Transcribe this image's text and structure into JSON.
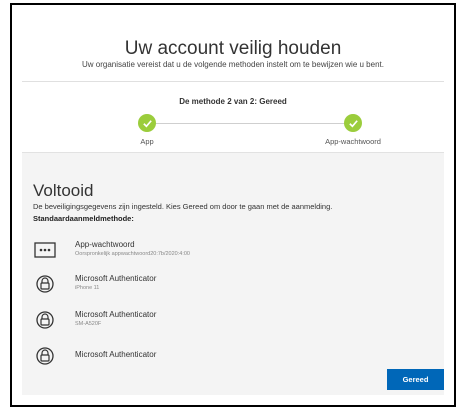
{
  "header": {
    "title": "Uw account veilig houden",
    "subtitle": "Uw organisatie vereist dat u de volgende methoden instelt om te bewijzen wie u bent."
  },
  "progress": {
    "text": "De methode 2 van 2: Gereed",
    "steps": [
      {
        "label": "App",
        "icon": "check-icon",
        "status": "complete"
      },
      {
        "label": "App-wachtwoord",
        "icon": "check-icon",
        "status": "complete"
      }
    ],
    "accent_color": "#9bcd3c"
  },
  "content": {
    "heading": "Voltooid",
    "info": "De beveiligingsgegevens zijn ingesteld. Kies Gereed om door te gaan met de aanmelding.",
    "default_method_label": "Standaardaanmeldmethode:",
    "methods": [
      {
        "name": "App-wachtwoord",
        "detail": "Oorspronkelijk appwachtwoord20:7b/2020:4:00",
        "icon": "password-dots-icon"
      },
      {
        "name": "Microsoft Authenticator",
        "detail": "iPhone 11",
        "icon": "authenticator-lock-icon"
      },
      {
        "name": "Microsoft Authenticator",
        "detail": "SM-A520F",
        "icon": "authenticator-lock-icon"
      },
      {
        "name": "Microsoft Authenticator",
        "detail": "",
        "icon": "authenticator-lock-icon"
      }
    ]
  },
  "actions": {
    "done_label": "Gereed",
    "button_color": "#0067b8"
  }
}
